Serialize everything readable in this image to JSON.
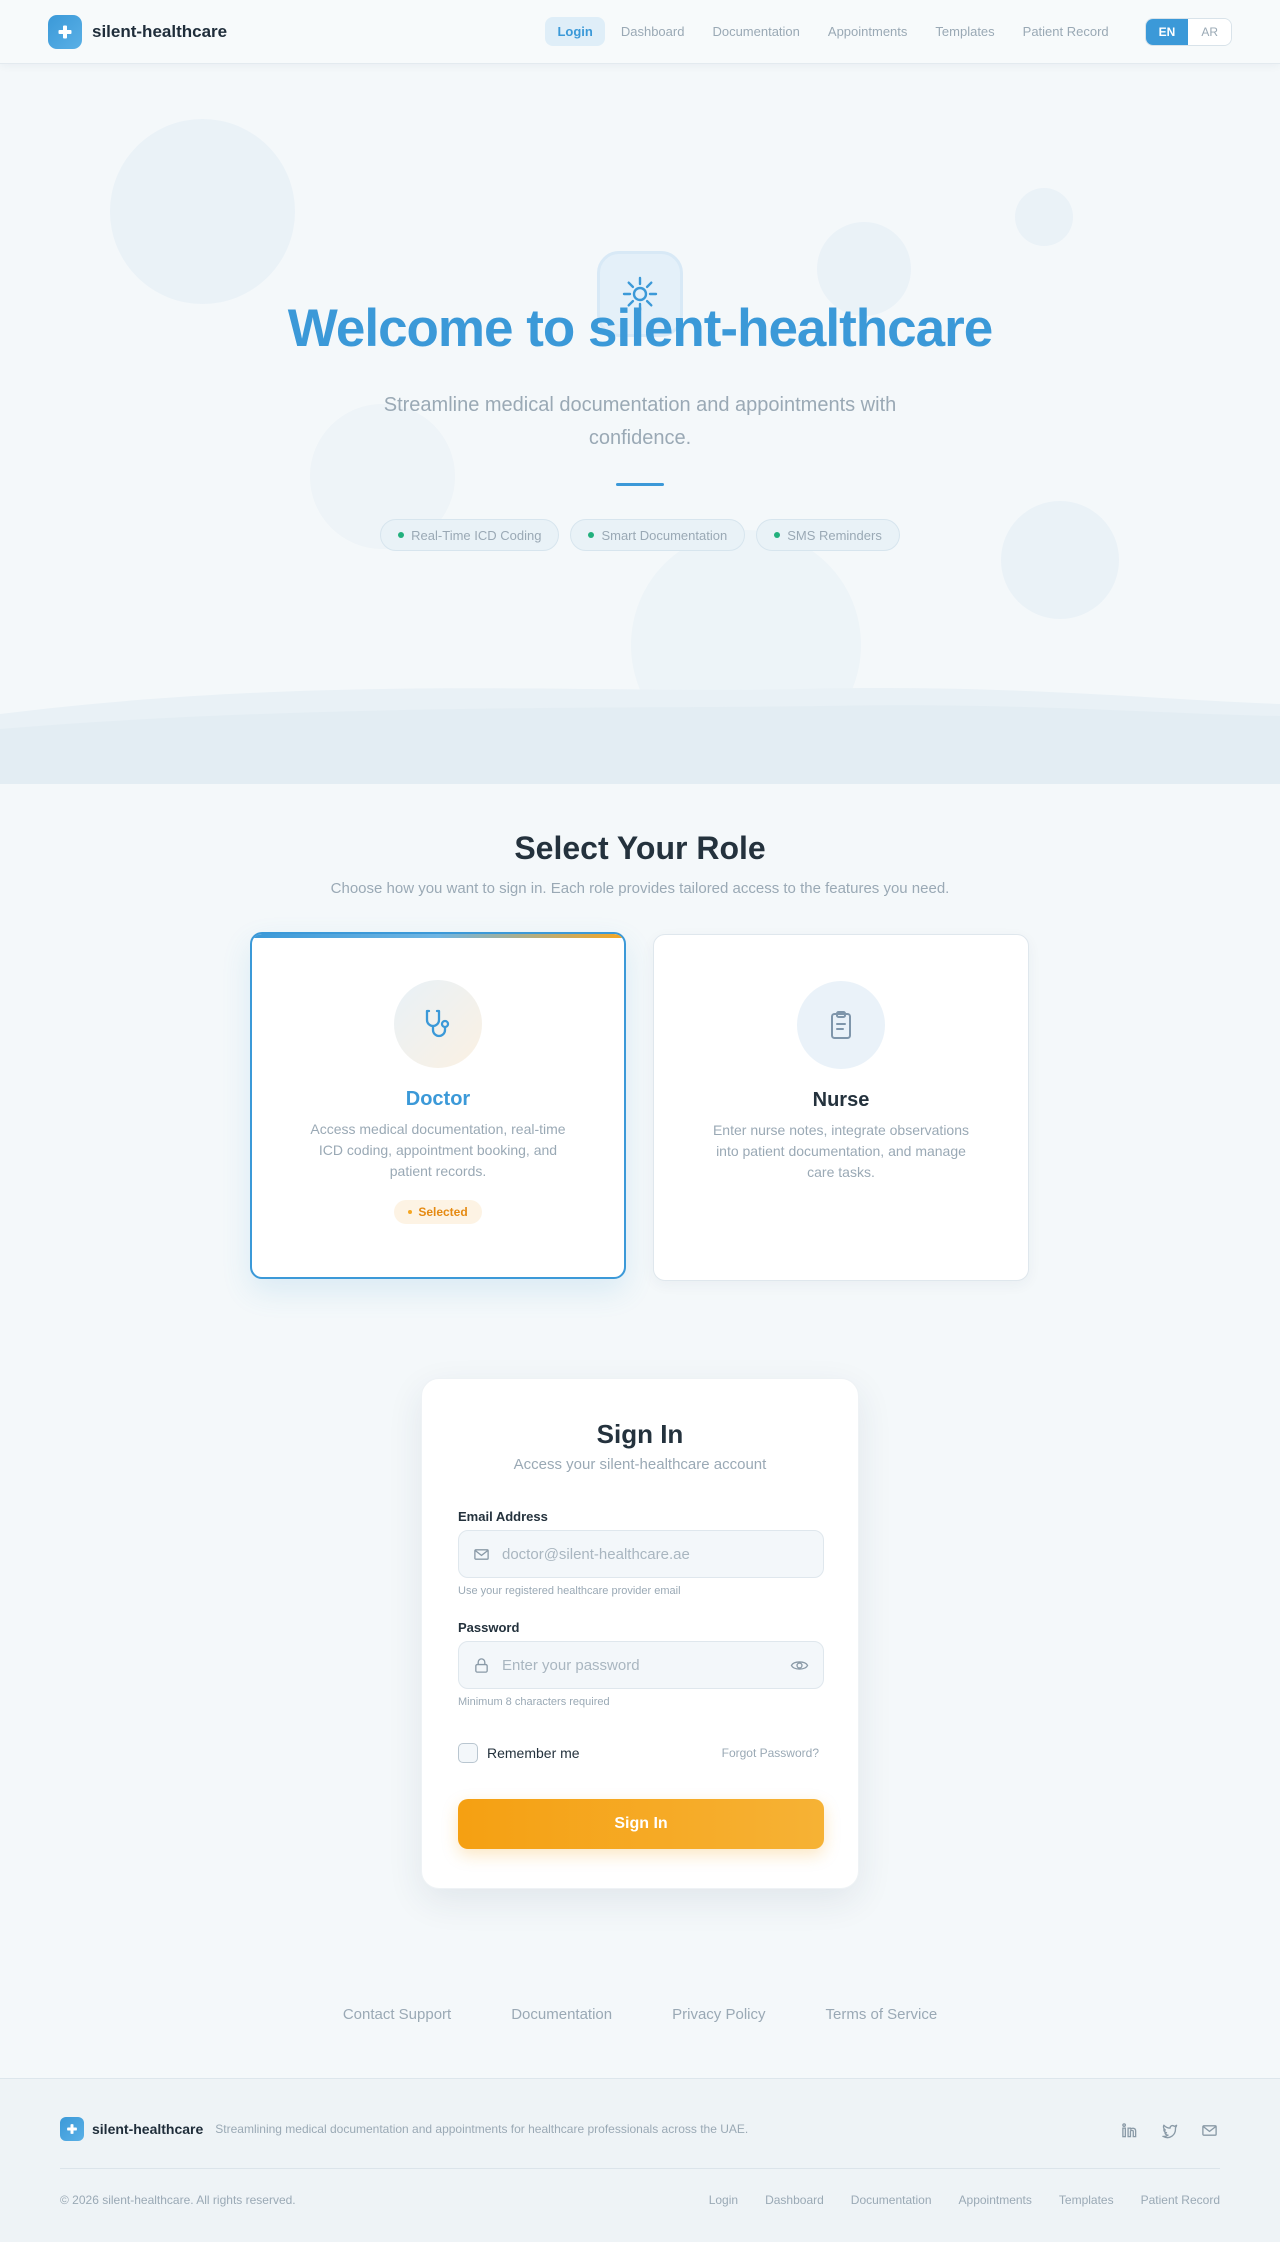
{
  "nav": {
    "brand": "silent-healthcare",
    "links": [
      "Login",
      "Dashboard",
      "Documentation",
      "Appointments",
      "Templates",
      "Patient Record"
    ],
    "active": "Login",
    "languages": [
      "EN",
      "AR"
    ],
    "selected_language": "EN"
  },
  "hero": {
    "title": "Welcome to silent-healthcare",
    "subtitle": "Streamline medical documentation and appointments with confidence.",
    "chips": [
      "Real-Time ICD Coding",
      "Smart Documentation",
      "SMS Reminders"
    ]
  },
  "roles": {
    "title": "Select Your Role",
    "subtitle": "Choose how you want to sign in. Each role provides tailored access to the features you need.",
    "doctor": {
      "name": "Doctor",
      "description": "Access medical documentation, real-time ICD coding, appointment booking, and patient records.",
      "badge": "Selected",
      "icon": "stethoscope-icon"
    },
    "nurse": {
      "name": "Nurse",
      "description": "Enter nurse notes, integrate observations into patient documentation, and manage care tasks.",
      "icon": "clipboard-icon"
    }
  },
  "signin": {
    "title": "Sign In",
    "subtitle": "Access your silent-healthcare account",
    "email_label": "Email Address",
    "email_placeholder": "doctor@silent-healthcare.ae",
    "email_hint": "Use your registered healthcare provider email",
    "password_label": "Password",
    "password_placeholder": "Enter your password",
    "password_hint": "Minimum 8 characters required",
    "remember": "Remember me",
    "forgot": "Forgot Password?",
    "button": "Sign In"
  },
  "links_row": [
    "Contact Support",
    "Documentation",
    "Privacy Policy",
    "Terms of Service"
  ],
  "footer": {
    "brand": "silent-healthcare",
    "tagline": "Streamlining medical documentation and appointments for healthcare professionals across the UAE.",
    "copyright": "© 2026 silent-healthcare. All rights reserved.",
    "links": [
      "Login",
      "Dashboard",
      "Documentation",
      "Appointments",
      "Templates",
      "Patient Record"
    ],
    "socials": [
      "linkedin-icon",
      "twitter-icon",
      "mail-icon"
    ]
  },
  "colors": {
    "primary": "#3b99d8",
    "accent": "#f5a623",
    "success": "#22b07d",
    "muted": "#9aa9b5",
    "ink": "#24323d"
  }
}
